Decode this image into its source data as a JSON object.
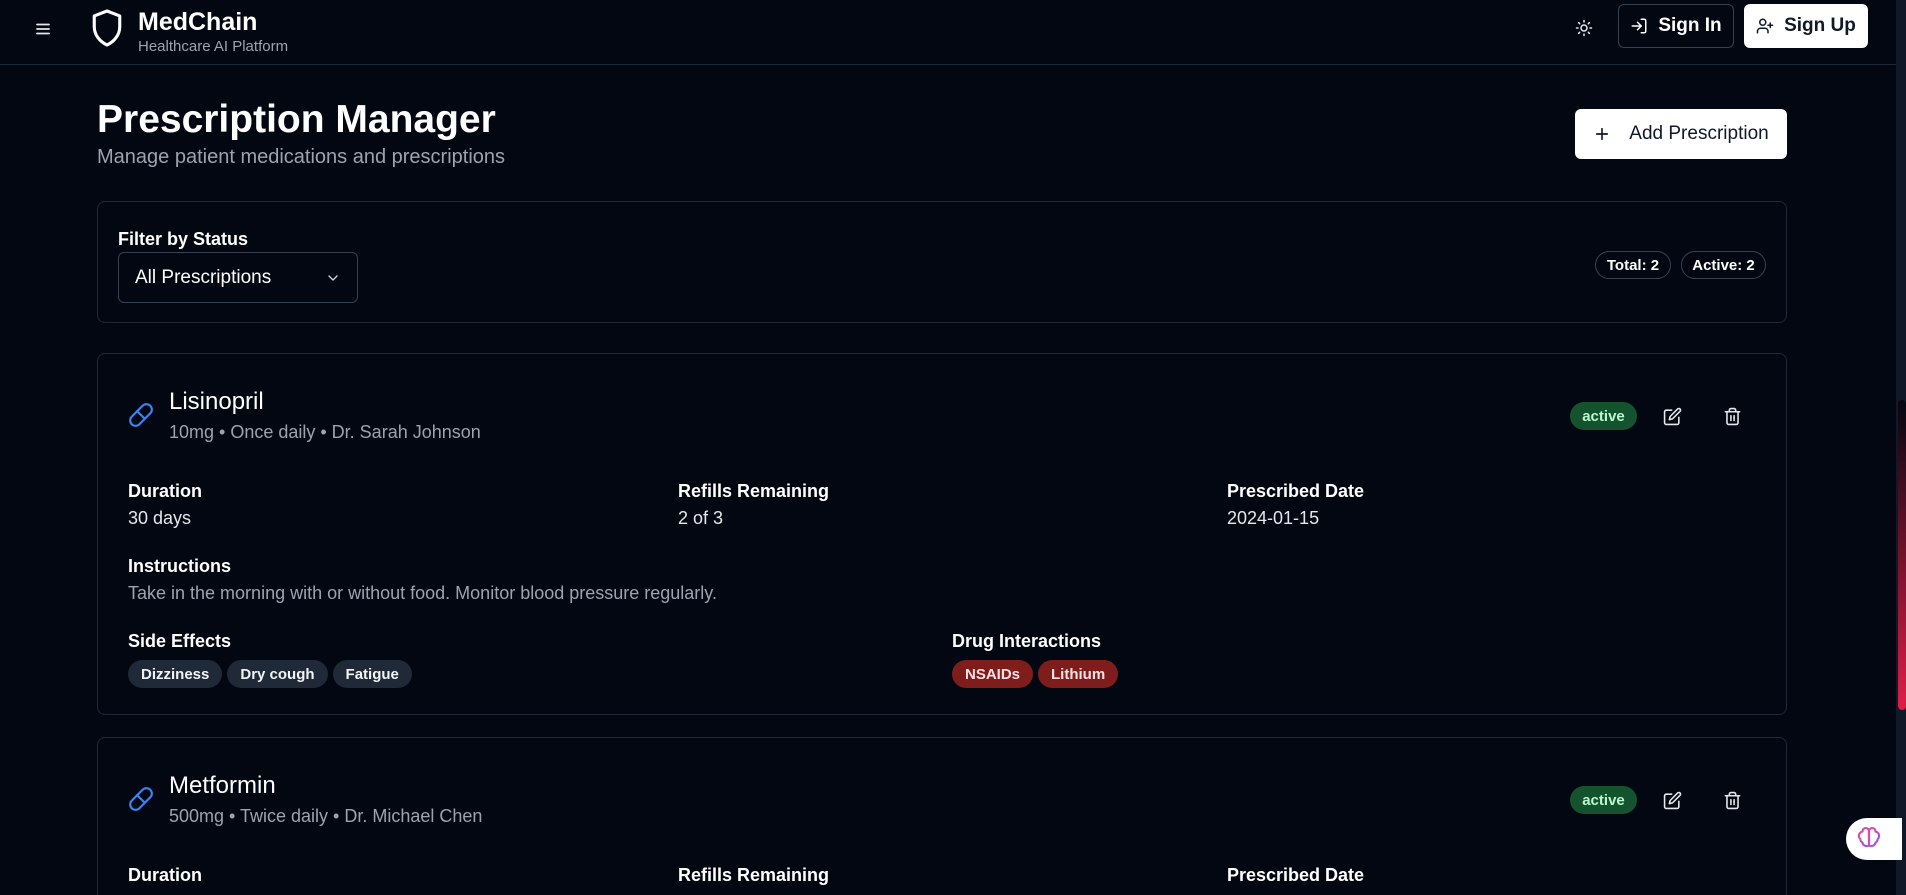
{
  "header": {
    "brand_title": "MedChain",
    "brand_subtitle": "Healthcare AI Platform",
    "sign_in_label": "Sign In",
    "sign_up_label": "Sign Up",
    "icons": [
      "menu-icon",
      "shield-icon",
      "sun-icon",
      "log-in-icon",
      "user-plus-icon"
    ]
  },
  "page": {
    "title": "Prescription Manager",
    "subtitle": "Manage patient medications and prescriptions",
    "add_button_label": "Add Prescription"
  },
  "filter": {
    "label": "Filter by Status",
    "selected": "All Prescriptions",
    "total_label": "Total: 2",
    "active_label": "Active: 2"
  },
  "labels": {
    "duration": "Duration",
    "refills": "Refills Remaining",
    "prescribed_date": "Prescribed Date",
    "instructions": "Instructions",
    "side_effects": "Side Effects",
    "drug_interactions": "Drug Interactions"
  },
  "prescriptions": [
    {
      "name": "Lisinopril",
      "meta": "10mg • Once daily • Dr. Sarah Johnson",
      "status": "active",
      "duration": "30 days",
      "refills": "2 of 3",
      "prescribed_date": "2024-01-15",
      "instructions": "Take in the morning with or without food. Monitor blood pressure regularly.",
      "side_effects": [
        "Dizziness",
        "Dry cough",
        "Fatigue"
      ],
      "drug_interactions": [
        "NSAIDs",
        "Lithium"
      ]
    },
    {
      "name": "Metformin",
      "meta": "500mg • Twice daily • Dr. Michael Chen",
      "status": "active"
    }
  ],
  "colors": {
    "background": "#030712",
    "border": "#1f2937",
    "status_active_bg": "#14532d",
    "drug_chip_bg": "#7f1d1d",
    "side_chip_bg": "#1f2937",
    "pill_icon": "#3b82f6"
  }
}
